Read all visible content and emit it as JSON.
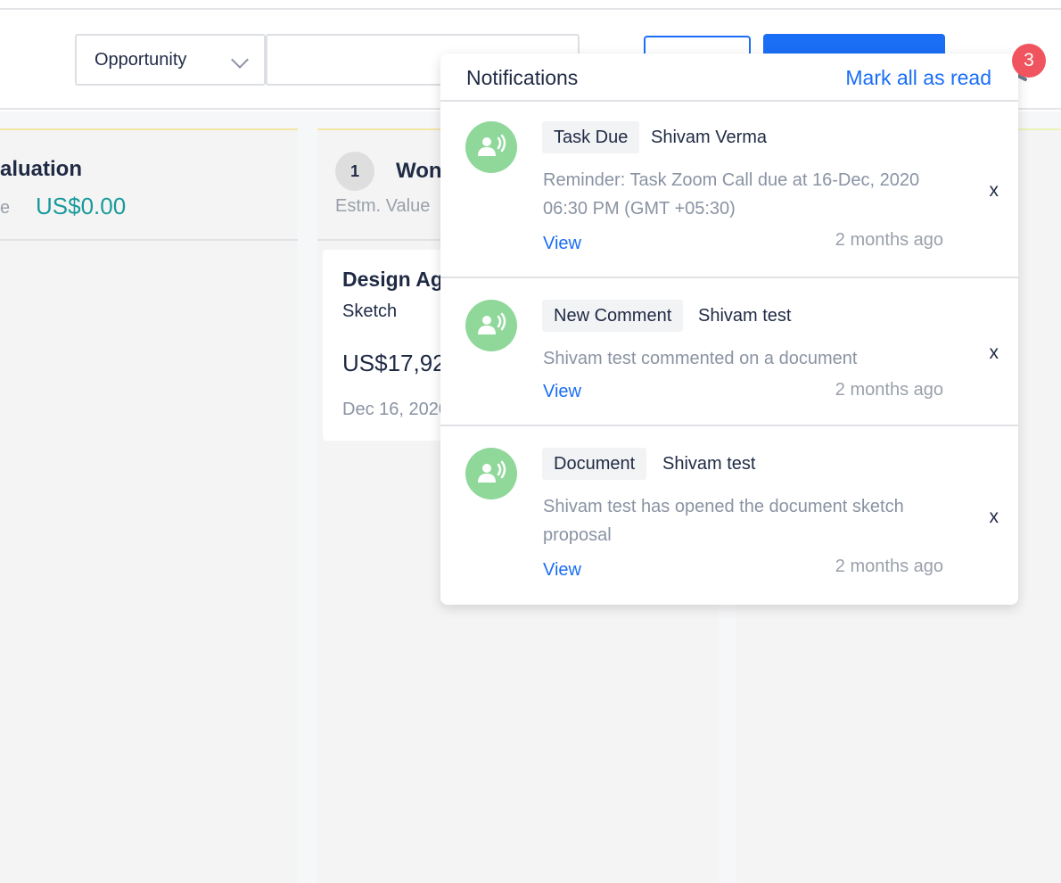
{
  "header": {
    "filter_select": {
      "value": "Opportunity"
    },
    "search": {
      "placeholder": ""
    },
    "notification_count": "3"
  },
  "board": {
    "columns": [
      {
        "title": "aluation",
        "estm_label": "e",
        "estm_value": "US$0.00"
      },
      {
        "count": "1",
        "title": "Won",
        "estm_label": "Estm. Value"
      }
    ],
    "card": {
      "title": "Design Ag",
      "subtitle": "Sketch",
      "amount": "US$17,92",
      "date": "Dec 16, 2020"
    }
  },
  "notifications": {
    "title": "Notifications",
    "mark_all_label": "Mark all as read",
    "items": [
      {
        "tag": "Task Due",
        "who": "Shivam Verma",
        "message": "Reminder: Task Zoom Call due at 16-Dec, 2020 06:30 PM (GMT +05:30)",
        "view_label": "View",
        "time": "2 months ago",
        "close_label": "x"
      },
      {
        "tag": "New Comment",
        "who": "Shivam test",
        "message": "Shivam test commented on a document",
        "view_label": "View",
        "time": "2 months ago",
        "close_label": "x"
      },
      {
        "tag": "Document",
        "who": "Shivam test",
        "message": "Shivam test has opened the document sketch proposal",
        "view_label": "View",
        "time": "2 months ago",
        "close_label": "x"
      }
    ]
  },
  "colors": {
    "accent": "#1a6ef5",
    "badge": "#f0555f",
    "avatar": "#8fd89a",
    "value_teal": "#1a9a9a"
  },
  "icons": {
    "dropdown": "chevron-down-icon",
    "bell": "bell-icon",
    "avatar": "person-speaking-icon"
  }
}
